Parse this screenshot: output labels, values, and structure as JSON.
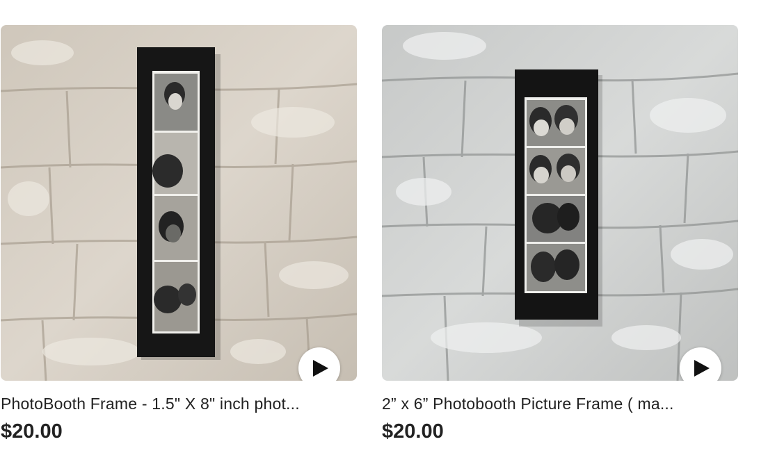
{
  "listings": [
    {
      "title": "PhotoBooth Frame - 1.5\" X 8\" inch phot...",
      "price": "$20.00",
      "image_alt": "Black photobooth strip frame with four black-and-white photos on a white painted brick wall",
      "has_video": true
    },
    {
      "title": "2” x 6” Photobooth Picture Frame ( ma...",
      "price": "$20.00",
      "image_alt": "Black photobooth picture frame with four black-and-white couple photos on a white painted brick wall",
      "has_video": true
    }
  ],
  "icons": {
    "play": "play-icon"
  },
  "colors": {
    "text": "#222222",
    "play_button_bg": "#ffffff",
    "frame": "#141414",
    "wall_left": "#d6cfc4",
    "wall_right": "#c9cbca"
  }
}
